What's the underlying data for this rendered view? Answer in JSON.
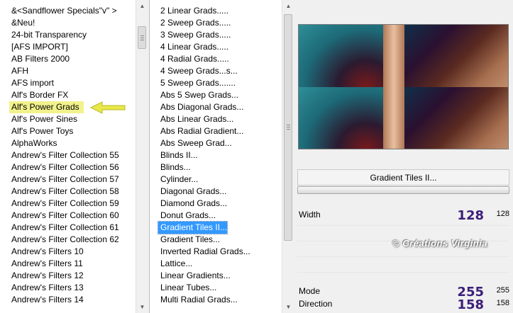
{
  "left_list": {
    "items": [
      "&<Sandflower Specials\"v\" >",
      "&Neu!",
      "24-bit Transparency",
      "[AFS IMPORT]",
      "AB Filters 2000",
      "AFH",
      "AFS import",
      "Alf's Border FX",
      "Alf's Power Grads",
      "Alf's Power Sines",
      "Alf's Power Toys",
      "AlphaWorks",
      "Andrew's Filter Collection 55",
      "Andrew's Filter Collection 56",
      "Andrew's Filter Collection 57",
      "Andrew's Filter Collection 58",
      "Andrew's Filter Collection 59",
      "Andrew's Filter Collection 60",
      "Andrew's Filter Collection 61",
      "Andrew's Filter Collection 62",
      "Andrew's Filters 10",
      "Andrew's Filters 11",
      "Andrew's Filters 12",
      "Andrew's Filters 13",
      "Andrew's Filters 14"
    ],
    "highlighted_index": 8
  },
  "mid_list": {
    "items": [
      "2 Linear Grads.....",
      "2 Sweep Grads.....",
      "3 Sweep Grads.....",
      "4 Linear Grads.....",
      "4 Radial Grads.....",
      "4 Sweep Grads...s...",
      "5 Sweep Grads.......",
      "Abs 5 Swep Grads...",
      "Abs Diagonal Grads...",
      "Abs Linear Grads...",
      "Abs Radial Gradient...",
      "Abs Sweep Grad...",
      "Blinds II...",
      "Blinds...",
      "Cylinder...",
      "Diagonal Grads...",
      "Diamond Grads...",
      "Donut Grads...",
      "Gradient Tiles II...",
      "Gradient Tiles...",
      "Inverted Radial Grads...",
      "Lattice...",
      "Linear Gradients...",
      "Linear Tubes...",
      "Multi Radial Grads..."
    ],
    "selected_index": 18
  },
  "filter": {
    "title": "Gradient Tiles II..."
  },
  "params": [
    {
      "label": "Width",
      "big": "128",
      "small": "128"
    },
    {
      "label": "Mode",
      "big": "255",
      "small": "255"
    },
    {
      "label": "Direction",
      "big": "158",
      "small": "158"
    }
  ],
  "watermark": "© Créations Virginia",
  "colors": {
    "highlight": "#f2f28c",
    "selection": "#3399ff",
    "value_text": "#3b1e7a",
    "arrow": "#e8e84a"
  },
  "icons": {
    "arrow": "left-pointing-arrow-icon",
    "scroll_up": "scroll-up-arrow-icon",
    "scroll_down": "scroll-down-arrow-icon"
  }
}
